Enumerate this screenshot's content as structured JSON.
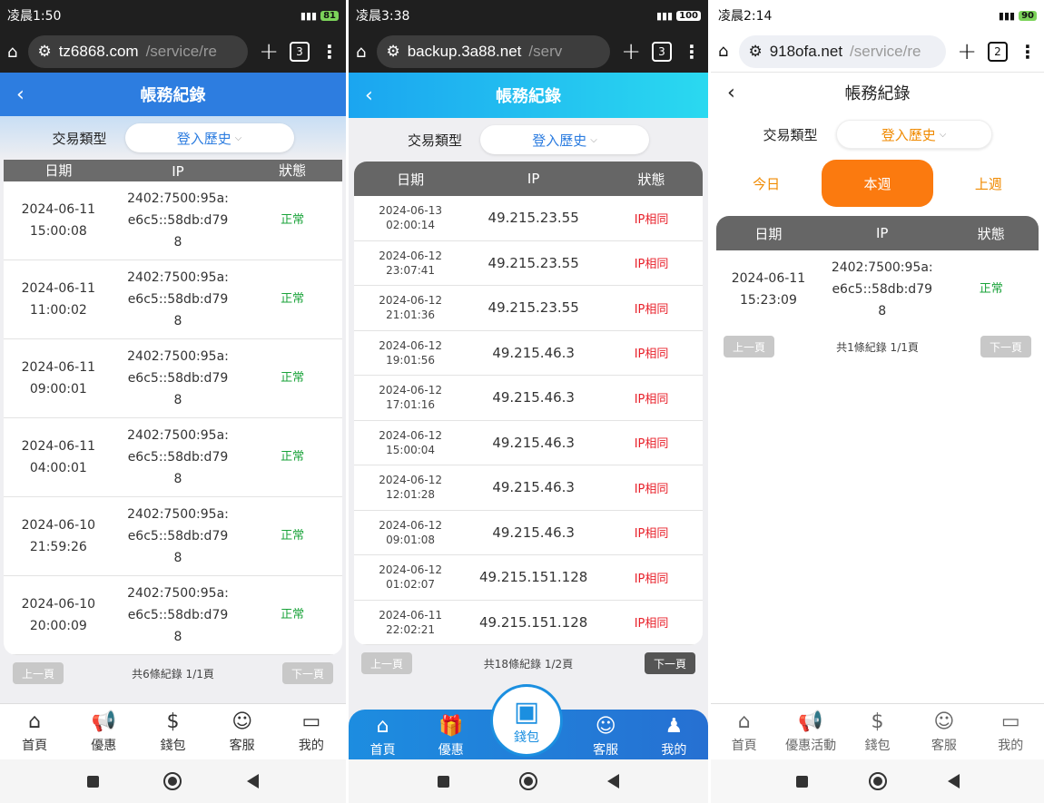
{
  "phones": [
    {
      "status": {
        "time": "凌晨1:50",
        "battery": "81"
      },
      "url": {
        "domain": "tz6868.com",
        "path": "/service/re",
        "tabs": "3"
      },
      "title": "帳務紀錄",
      "filter": {
        "label": "交易類型",
        "dropdown": "登入歷史"
      },
      "columns": [
        "日期",
        "IP",
        "狀態"
      ],
      "rows": [
        {
          "date": "2024-06-11",
          "time": "15:00:08",
          "ip1": "2402:7500:95a:",
          "ip2": "e6c5::58db:d79",
          "ip3": "8",
          "status": "正常"
        },
        {
          "date": "2024-06-11",
          "time": "11:00:02",
          "ip1": "2402:7500:95a:",
          "ip2": "e6c5::58db:d79",
          "ip3": "8",
          "status": "正常"
        },
        {
          "date": "2024-06-11",
          "time": "09:00:01",
          "ip1": "2402:7500:95a:",
          "ip2": "e6c5::58db:d79",
          "ip3": "8",
          "status": "正常"
        },
        {
          "date": "2024-06-11",
          "time": "04:00:01",
          "ip1": "2402:7500:95a:",
          "ip2": "e6c5::58db:d79",
          "ip3": "8",
          "status": "正常"
        },
        {
          "date": "2024-06-10",
          "time": "21:59:26",
          "ip1": "2402:7500:95a:",
          "ip2": "e6c5::58db:d79",
          "ip3": "8",
          "status": "正常"
        },
        {
          "date": "2024-06-10",
          "time": "20:00:09",
          "ip1": "2402:7500:95a:",
          "ip2": "e6c5::58db:d79",
          "ip3": "8",
          "status": "正常"
        }
      ],
      "pager": {
        "prev": "上一頁",
        "info": "共6條紀錄 1/1頁",
        "next": "下一頁"
      },
      "tabs": [
        "首頁",
        "優惠",
        "錢包",
        "客服",
        "我的"
      ]
    },
    {
      "status": {
        "time": "凌晨3:38",
        "battery": "100"
      },
      "url": {
        "domain": "backup.3a88.net",
        "path": "/serv",
        "tabs": "3"
      },
      "title": "帳務紀錄",
      "filter": {
        "label": "交易類型",
        "dropdown": "登入歷史"
      },
      "columns": [
        "日期",
        "IP",
        "狀態"
      ],
      "rows": [
        {
          "date": "2024-06-13",
          "time": "02:00:14",
          "ip": "49.215.23.55",
          "status": "IP相同"
        },
        {
          "date": "2024-06-12",
          "time": "23:07:41",
          "ip": "49.215.23.55",
          "status": "IP相同"
        },
        {
          "date": "2024-06-12",
          "time": "21:01:36",
          "ip": "49.215.23.55",
          "status": "IP相同"
        },
        {
          "date": "2024-06-12",
          "time": "19:01:56",
          "ip": "49.215.46.3",
          "status": "IP相同"
        },
        {
          "date": "2024-06-12",
          "time": "17:01:16",
          "ip": "49.215.46.3",
          "status": "IP相同"
        },
        {
          "date": "2024-06-12",
          "time": "15:00:04",
          "ip": "49.215.46.3",
          "status": "IP相同"
        },
        {
          "date": "2024-06-12",
          "time": "12:01:28",
          "ip": "49.215.46.3",
          "status": "IP相同"
        },
        {
          "date": "2024-06-12",
          "time": "09:01:08",
          "ip": "49.215.46.3",
          "status": "IP相同"
        },
        {
          "date": "2024-06-12",
          "time": "01:02:07",
          "ip": "49.215.151.128",
          "status": "IP相同"
        },
        {
          "date": "2024-06-11",
          "time": "22:02:21",
          "ip": "49.215.151.128",
          "status": "IP相同"
        }
      ],
      "pager": {
        "prev": "上一頁",
        "info": "共18條紀錄 1/2頁",
        "next": "下一頁"
      },
      "tabs": [
        "首頁",
        "優惠",
        "錢包",
        "客服",
        "我的"
      ]
    },
    {
      "status": {
        "time": "凌晨2:14",
        "battery": "90"
      },
      "url": {
        "domain": "918ofa.net",
        "path": "/service/re",
        "tabs": "2"
      },
      "title": "帳務紀錄",
      "filter": {
        "label": "交易類型",
        "dropdown": "登入歷史"
      },
      "periods": [
        "今日",
        "本週",
        "上週"
      ],
      "columns": [
        "日期",
        "IP",
        "狀態"
      ],
      "rows": [
        {
          "date": "2024-06-11",
          "time": "15:23:09",
          "ip1": "2402:7500:95a:",
          "ip2": "e6c5::58db:d79",
          "ip3": "8",
          "status": "正常"
        }
      ],
      "pager": {
        "prev": "上一頁",
        "info": "共1條紀錄 1/1頁",
        "next": "下一頁"
      },
      "tabs": [
        "首頁",
        "優惠活動",
        "錢包",
        "客服",
        "我的"
      ]
    }
  ],
  "colors": {
    "blue": "#2d7de0",
    "green": "#1aa33a",
    "red": "#e8202a",
    "orange": "#fb7a0f"
  }
}
